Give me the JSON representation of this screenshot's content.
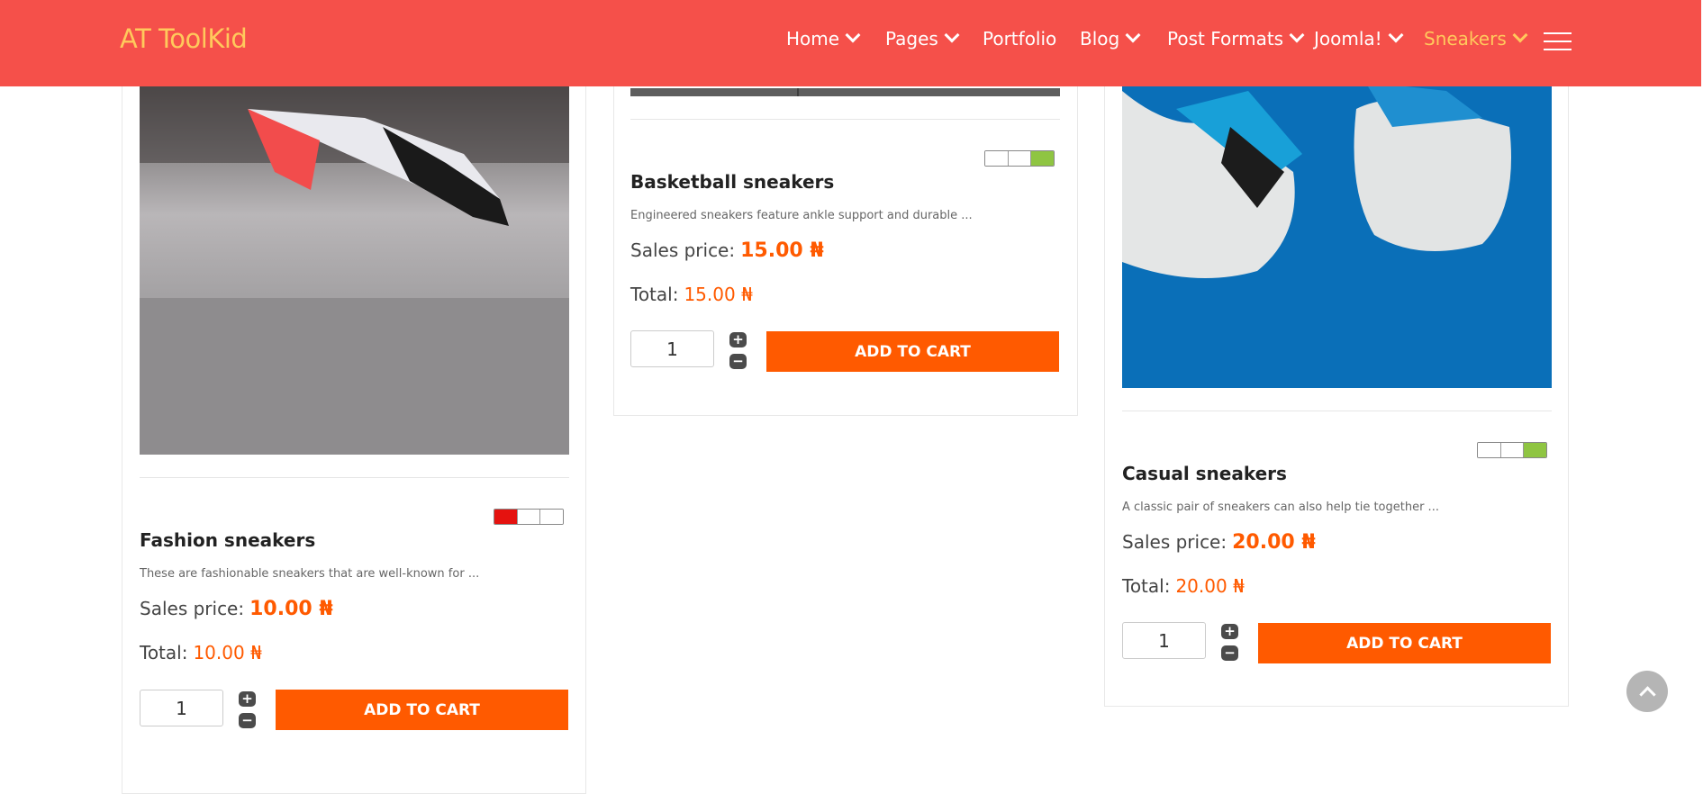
{
  "header": {
    "brand": "AT ToolKid",
    "nav": [
      {
        "label": "Home",
        "dropdown": true
      },
      {
        "label": "Pages",
        "dropdown": true
      },
      {
        "label": "Portfolio",
        "dropdown": false
      },
      {
        "label": "Blog",
        "dropdown": true
      },
      {
        "label": "Post Formats",
        "dropdown": true
      },
      {
        "label": "Joomla!",
        "dropdown": true
      },
      {
        "label": "Sneakers",
        "dropdown": true,
        "active": true
      }
    ],
    "menu_icon": "hamburger-icon"
  },
  "products": [
    {
      "title": "Fashion sneakers",
      "description": "These are fashionable sneakers that are well-known for ...",
      "sales_label": "Sales price:",
      "sales_price": "10.00 ₦",
      "total_label": "Total:",
      "total_price": "10.00 ₦",
      "quantity": "1",
      "plus": "+",
      "minus": "−",
      "button": "ADD TO CART",
      "rating_level": "1 of 3 (red)"
    },
    {
      "title": "Basketball sneakers",
      "description": "Engineered sneakers feature ankle support and durable ...",
      "sales_label": "Sales price:",
      "sales_price": "15.00 ₦",
      "total_label": "Total:",
      "total_price": "15.00 ₦",
      "quantity": "1",
      "plus": "+",
      "minus": "−",
      "button": "ADD TO CART",
      "rating_level": "3 of 3 (green)"
    },
    {
      "title": "Casual sneakers",
      "description": "A classic pair of sneakers can also help tie together ...",
      "sales_label": "Sales price:",
      "sales_price": "20.00 ₦",
      "total_label": "Total:",
      "total_price": "20.00 ₦",
      "quantity": "1",
      "plus": "+",
      "minus": "−",
      "button": "ADD TO CART",
      "rating_level": "3 of 3 (green)"
    }
  ],
  "colors": {
    "header_bg": "#f5504a",
    "brand": "#ffc95c",
    "accent": "#ff5a00",
    "rating_red": "#e5120f",
    "rating_green": "#8fc542"
  },
  "scroll_top_icon": "chevron-up-icon"
}
